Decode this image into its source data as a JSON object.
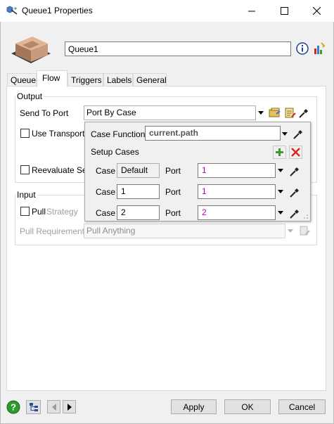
{
  "window": {
    "title": "Queue1  Properties",
    "minimize_icon": "minimize-icon",
    "maximize_icon": "maximize-icon",
    "close_icon": "close-icon"
  },
  "object": {
    "name_value": "Queue1",
    "info_icon": "info-icon",
    "stats_icon": "statistics-icon"
  },
  "tabs": [
    {
      "label": "Queue"
    },
    {
      "label": "Flow"
    },
    {
      "label": "Triggers"
    },
    {
      "label": "Labels"
    },
    {
      "label": "General"
    }
  ],
  "output": {
    "legend": "Output",
    "send_to_port_label": "Send To Port",
    "send_to_port_value": "Port By Case",
    "use_transport_label": "Use Transport",
    "reevaluate_label": "Reevaluate Sen"
  },
  "popup": {
    "case_function_label": "Case Function",
    "case_function_value": "current.path",
    "setup_cases_label": "Setup Cases",
    "rows": [
      {
        "case_label": "Case",
        "case_value": "Default",
        "port_label": "Port",
        "port_value": "1"
      },
      {
        "case_label": "Case",
        "case_value": "1",
        "port_label": "Port",
        "port_value": "1"
      },
      {
        "case_label": "Case",
        "case_value": "2",
        "port_label": "Port",
        "port_value": "2"
      }
    ]
  },
  "input": {
    "legend": "Input",
    "pull_label": "Pull",
    "strategy_label": "Strategy",
    "pull_requirement_label": "Pull Requirement",
    "pull_requirement_value": "Pull Anything"
  },
  "footer": {
    "apply": "Apply",
    "ok": "OK",
    "cancel": "Cancel"
  },
  "colors": {
    "port_value": "#b000b0",
    "add_green": "#3c9c2c",
    "remove_red": "#e02020",
    "help_green": "#2e9a2e"
  }
}
